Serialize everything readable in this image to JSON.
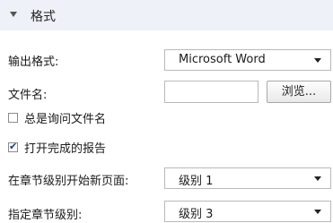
{
  "section": {
    "title": "格式"
  },
  "output_format": {
    "label": "输出格式:",
    "value": "Microsoft Word"
  },
  "filename": {
    "label": "文件名:",
    "value": "",
    "browse_label": "浏览..."
  },
  "always_ask": {
    "label": "总是询问文件名",
    "checked": false
  },
  "open_report": {
    "label": "打开完成的报告",
    "checked": true,
    "check_glyph": "✔"
  },
  "chapter_new_page": {
    "label": "在章节级别开始新页面:",
    "value": "级别 1"
  },
  "chapter_level": {
    "label": "指定章节级别:",
    "value": "级别 3"
  }
}
